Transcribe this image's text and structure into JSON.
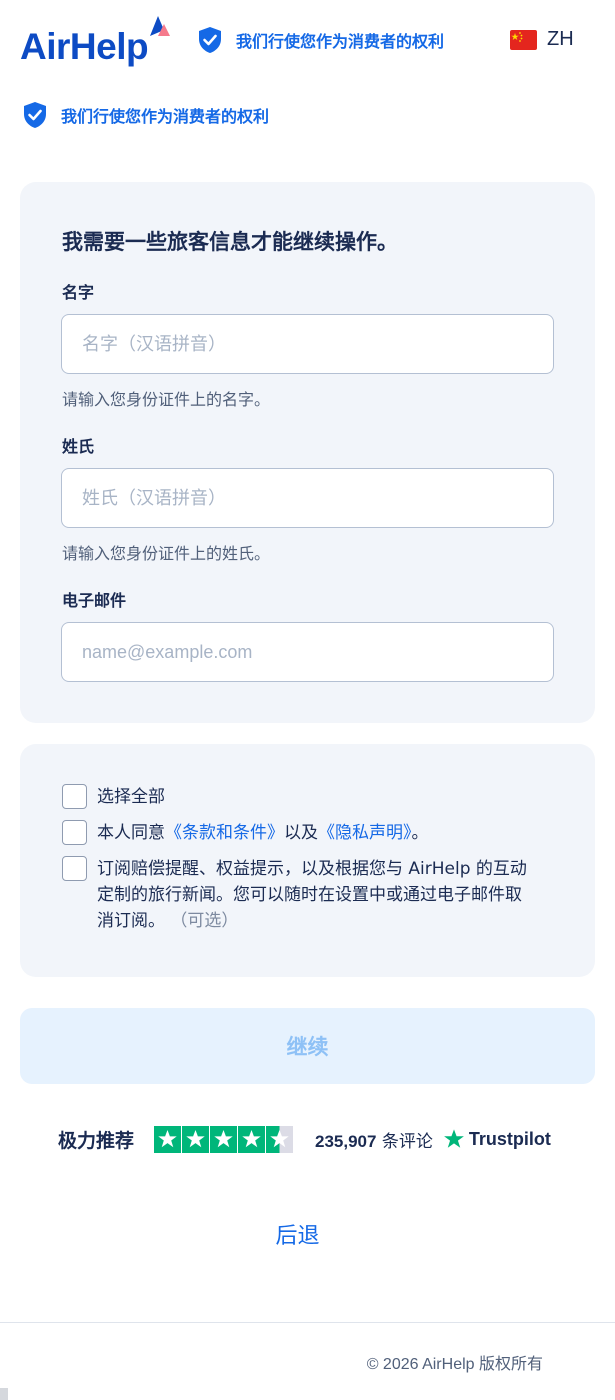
{
  "header": {
    "logo_text": "AirHelp",
    "trust_text": "我们行使您作为消费者的权利",
    "language": "ZH"
  },
  "subheader": {
    "trust_text": "我们行使您作为消费者的权利"
  },
  "passenger_form": {
    "title": "我需要一些旅客信息才能继续操作。",
    "first_name": {
      "label": "名字",
      "placeholder": "名字（汉语拼音）",
      "value": "",
      "hint": "请输入您身份证件上的名字。"
    },
    "last_name": {
      "label": "姓氏",
      "placeholder": "姓氏（汉语拼音）",
      "value": "",
      "hint": "请输入您身份证件上的姓氏。"
    },
    "email": {
      "label": "电子邮件",
      "placeholder": "name@example.com",
      "value": ""
    }
  },
  "consents": {
    "select_all": "选择全部",
    "terms_prefix": "本人同意",
    "terms_link": "《条款和条件》",
    "terms_middle": "以及",
    "privacy_link": "《隐私声明》",
    "terms_suffix": "。",
    "newsletter_text": "订阅赔偿提醒、权益提示，以及根据您与 AirHelp 的互动定制的旅行新闻。您可以随时在设置中或通过电子邮件取消订阅。",
    "newsletter_optional": "（可选）"
  },
  "actions": {
    "continue_label": "继续",
    "back_label": "后退"
  },
  "trustpilot": {
    "label": "极力推荐",
    "rating_stars": 4.5,
    "review_count": "235,907",
    "review_suffix": "条评论",
    "brand": "Trustpilot"
  },
  "footer": {
    "copyright": "© 2026 AirHelp 版权所有"
  },
  "colors": {
    "brand_blue": "#0d4bc4",
    "link_blue": "#1569e6",
    "card_bg": "#f2f5fa",
    "button_bg": "#e6f2fe",
    "trustpilot_green": "#00b67a"
  }
}
